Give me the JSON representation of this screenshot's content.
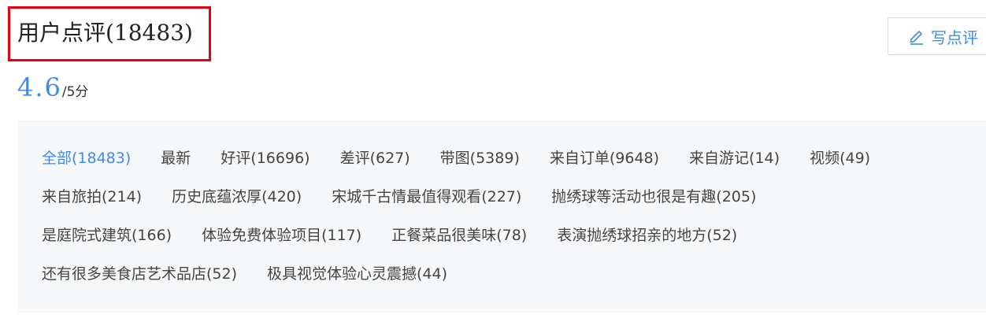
{
  "header": {
    "title": "用户点评(18483)"
  },
  "toolbar": {
    "write_label": "写点评",
    "write_icon": "pencil-icon"
  },
  "rating": {
    "score": "4.6",
    "unit": "/5分"
  },
  "colors": {
    "accent": "#3d8be8",
    "highlight_border": "#e60012",
    "panel_bg": "#f6f7f9"
  },
  "tags": {
    "rows": [
      [
        "全部(18483)",
        "最新",
        "好评(16696)",
        "差评(627)",
        "带图(5389)",
        "来自订单(9648)",
        "来自游记(14)",
        "视频(49)"
      ],
      [
        "来自旅拍(214)",
        "历史底蕴浓厚(420)",
        "宋城千古情最值得观看(227)",
        "抛绣球等活动也很是有趣(205)"
      ],
      [
        "是庭院式建筑(166)",
        "体验免费体验项目(117)",
        "正餐菜品很美味(78)",
        "表演抛绣球招亲的地方(52)"
      ],
      [
        "还有很多美食店艺术品店(52)",
        "极具视觉体验心灵震撼(44)"
      ]
    ],
    "active": "全部(18483)"
  }
}
